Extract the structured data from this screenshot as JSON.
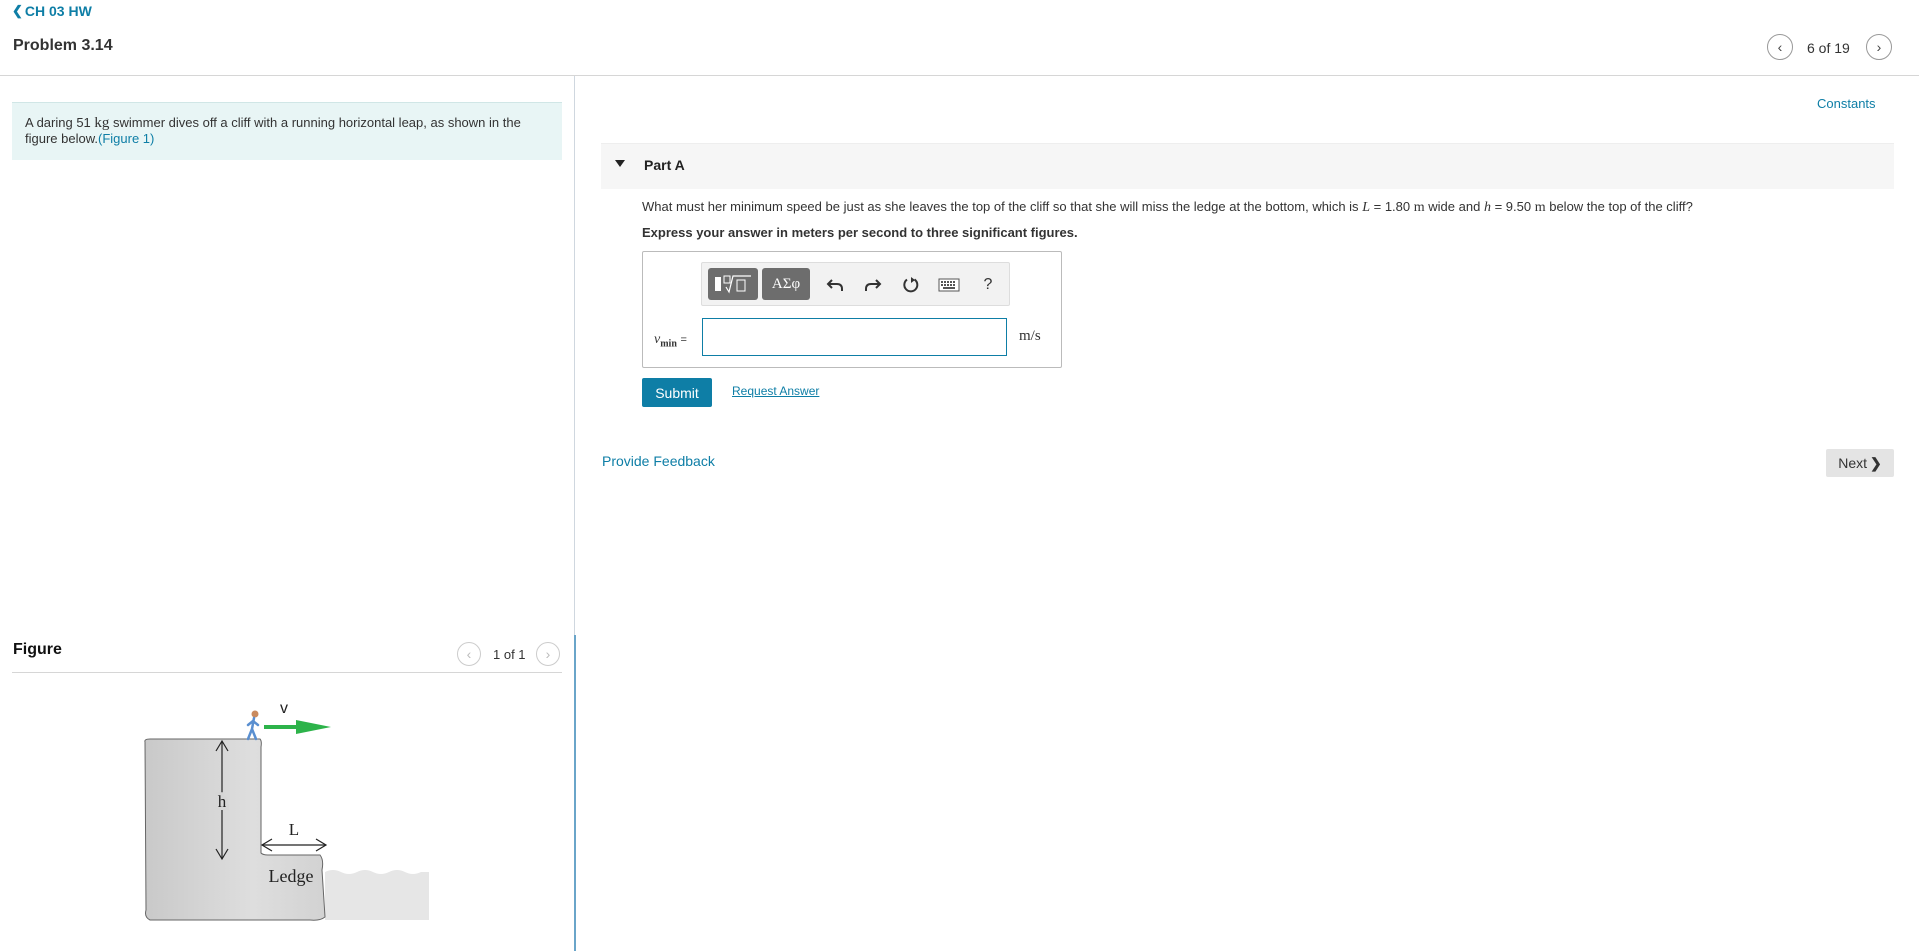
{
  "header": {
    "back_label": "CH 03 HW",
    "problem_title": "Problem 3.14",
    "counter": "6 of 19"
  },
  "intro": {
    "before_mass": "A daring 51",
    "mass_unit": "kg",
    "after_mass": "swimmer dives off a cliff with a running horizontal leap, as shown in the figure below.",
    "figure_link": "(Figure 1)"
  },
  "figure": {
    "heading": "Figure",
    "counter": "1 of 1",
    "labels": {
      "velocity": "v",
      "height": "h",
      "width": "L",
      "ledge": "Ledge"
    },
    "arrow_color": "#2db34a"
  },
  "constants_label": "Constants",
  "part": {
    "label": "Part A",
    "question_pre": "What must her minimum speed be just as she leaves the top of the cliff so that she will miss the ledge at the bottom, which is",
    "L_symbol": "L",
    "L_value": "= 1.80",
    "L_unit": "m",
    "mid_text": "wide and",
    "h_symbol": "h",
    "h_value": "= 9.50",
    "h_unit": "m",
    "question_post": "below the top of the cliff?",
    "instruction": "Express your answer in meters per second to three significant figures.",
    "answer": {
      "variable": "v",
      "subscript": "min",
      "equals": "=",
      "value": "",
      "unit": "m/s"
    },
    "toolbar": {
      "templates_icon": "template-sqrt-icon",
      "greek_label": "ΑΣφ",
      "undo_icon": "undo-icon",
      "redo_icon": "redo-icon",
      "reset_icon": "reset-icon",
      "keyboard_icon": "keyboard-icon",
      "help_label": "?"
    },
    "submit_label": "Submit",
    "request_answer_label": "Request Answer"
  },
  "footer": {
    "feedback_label": "Provide Feedback",
    "next_label": "Next"
  },
  "colors": {
    "accent": "#0e7ea6",
    "intro_bg": "#e8f5f5"
  }
}
